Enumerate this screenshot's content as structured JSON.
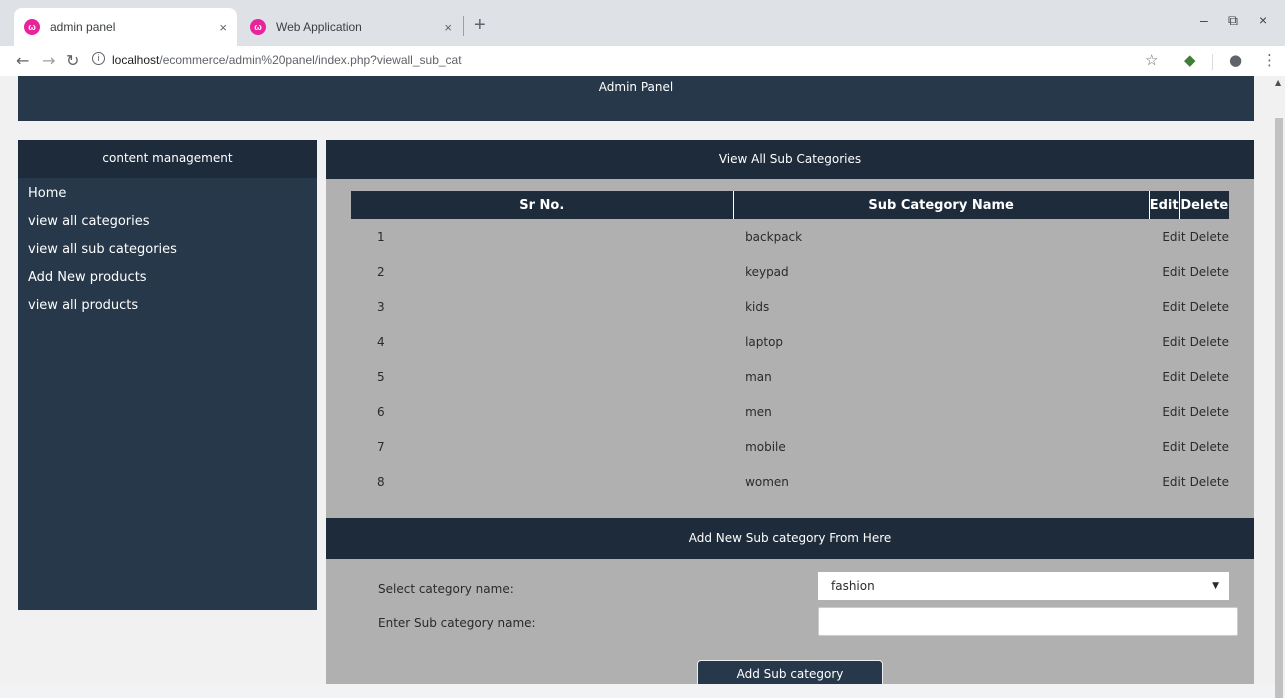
{
  "browser": {
    "tabs": [
      {
        "title": "admin panel",
        "close": "×",
        "favicon": "ω"
      },
      {
        "title": "Web Application",
        "close": "×",
        "favicon": "ω"
      }
    ],
    "new_tab": "+",
    "url_host": "localhost",
    "url_path": "/ecommerce/admin%20panel/index.php?viewall_sub_cat",
    "window_controls": {
      "minimize": "–",
      "maximize": "⧉",
      "close": "×"
    }
  },
  "header": {
    "title": "Admin Panel"
  },
  "sidebar": {
    "heading": "content management",
    "items": [
      "Home",
      "view all categories",
      "view all sub categories",
      "Add New products",
      "view all products"
    ]
  },
  "main": {
    "heading": "View All Sub Categories",
    "table": {
      "columns": [
        "Sr No.",
        "Sub Category Name",
        "Edit",
        "Delete"
      ],
      "rows": [
        {
          "sr": "1",
          "name": "backpack",
          "edit": "Edit",
          "delete": "Delete"
        },
        {
          "sr": "2",
          "name": "keypad",
          "edit": "Edit",
          "delete": "Delete"
        },
        {
          "sr": "3",
          "name": "kids",
          "edit": "Edit",
          "delete": "Delete"
        },
        {
          "sr": "4",
          "name": "laptop",
          "edit": "Edit",
          "delete": "Delete"
        },
        {
          "sr": "5",
          "name": "man",
          "edit": "Edit",
          "delete": "Delete"
        },
        {
          "sr": "6",
          "name": "men",
          "edit": "Edit",
          "delete": "Delete"
        },
        {
          "sr": "7",
          "name": "mobile",
          "edit": "Edit",
          "delete": "Delete"
        },
        {
          "sr": "8",
          "name": "women",
          "edit": "Edit",
          "delete": "Delete"
        }
      ]
    }
  },
  "add_form": {
    "heading": "Add New Sub category From Here",
    "category_label": "Select category name:",
    "category_value": "fashion",
    "subcat_label": "Enter Sub category name:",
    "subcat_value": "",
    "submit_label": "Add Sub category"
  },
  "colors": {
    "header_bg": "#27384a",
    "panel_head_bg": "#1e2b3a",
    "content_bg": "#b0b0b0"
  }
}
